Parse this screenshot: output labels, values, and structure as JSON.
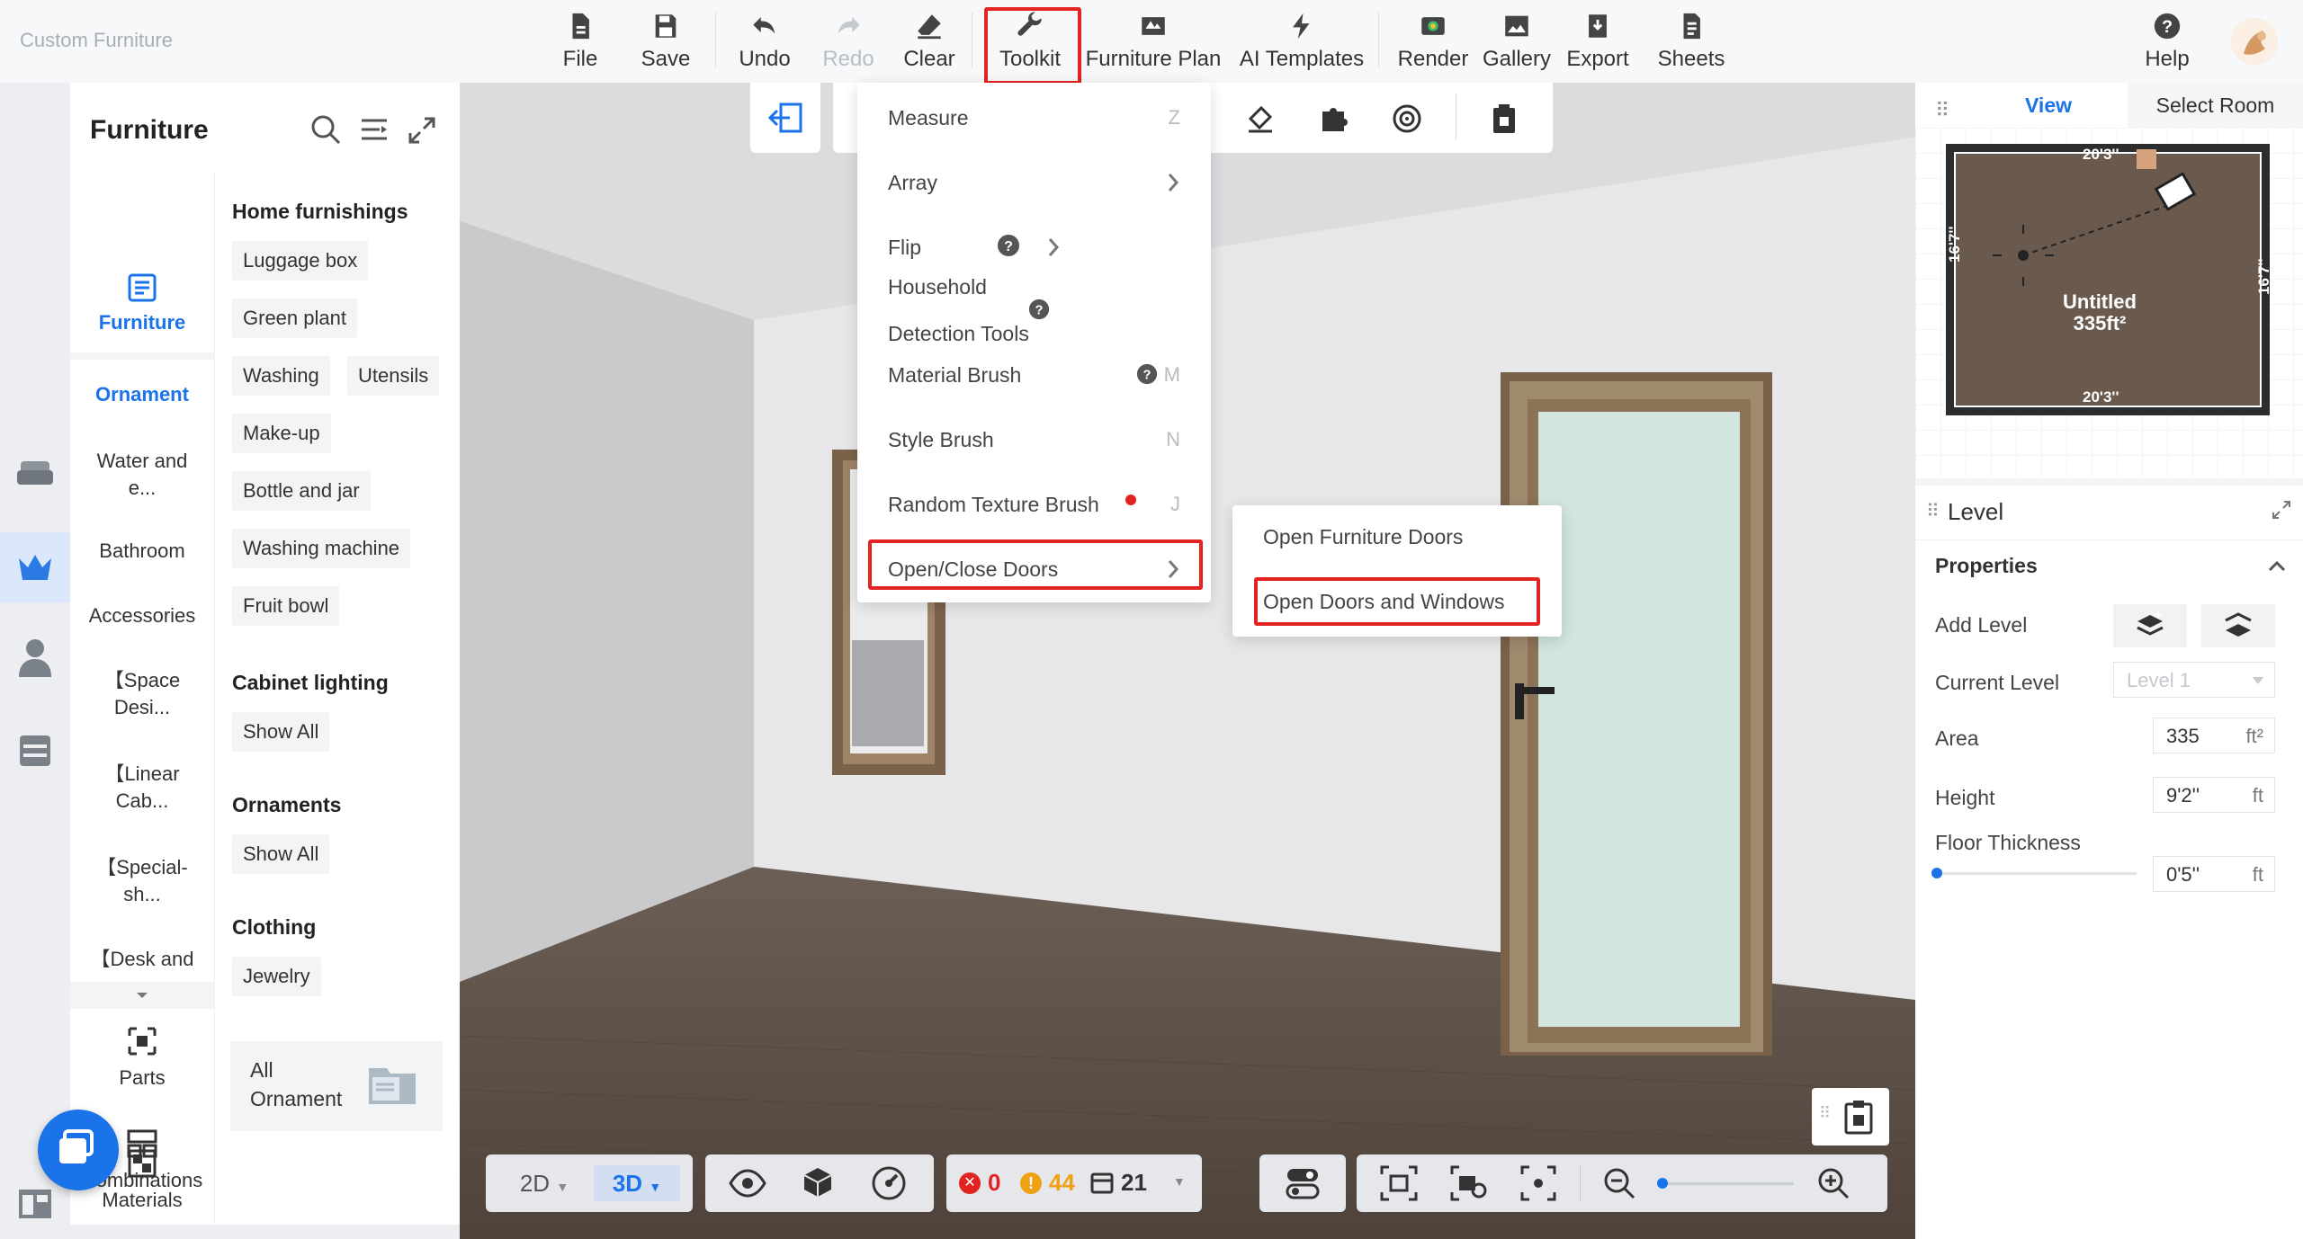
{
  "app": {
    "title": "Custom Furniture"
  },
  "toolbar": {
    "file": "File",
    "save": "Save",
    "undo": "Undo",
    "redo": "Redo",
    "clear": "Clear",
    "toolkit": "Toolkit",
    "furniture_plan": "Furniture Plan",
    "ai_templates": "AI Templates",
    "render": "Render",
    "gallery": "Gallery",
    "export": "Export",
    "sheets": "Sheets",
    "help": "Help"
  },
  "furniture_panel": {
    "title": "Furniture",
    "categories": [
      {
        "label": "Furniture"
      },
      {
        "label": "Ornament"
      },
      {
        "label": "Water and e..."
      },
      {
        "label": "Bathroom"
      },
      {
        "label": "Accessories"
      },
      {
        "label": "【Space Desi..."
      },
      {
        "label": "【Linear Cab..."
      },
      {
        "label": "【Special-sh..."
      },
      {
        "label": "【Desk and"
      },
      {
        "label": "Parts"
      },
      {
        "label": "Combinations"
      },
      {
        "label": "Materials"
      }
    ],
    "sections": {
      "home": {
        "title": "Home furnishings",
        "items": [
          "Luggage box",
          "Green plant",
          "Washing",
          "Utensils",
          "Make-up",
          "Bottle and jar",
          "Washing machine",
          "Fruit bowl"
        ]
      },
      "cabinet": {
        "title": "Cabinet lighting",
        "show_all": "Show All"
      },
      "ornaments": {
        "title": "Ornaments",
        "show_all": "Show All"
      },
      "clothing": {
        "title": "Clothing",
        "items": [
          "Jewelry"
        ]
      }
    },
    "all_ornament": "All Ornament"
  },
  "toolkit_menu": {
    "items": {
      "measure": "Measure",
      "measure_key": "Z",
      "array": "Array",
      "flip": "Flip",
      "household": "Household",
      "detection": "Detection Tools",
      "material_brush": "Material Brush",
      "material_brush_key": "M",
      "style_brush": "Style Brush",
      "style_brush_key": "N",
      "random_texture": "Random Texture Brush",
      "random_texture_key": "J",
      "open_close_doors": "Open/Close Doors"
    },
    "submenu": {
      "open_furniture_doors": "Open Furniture Doors",
      "open_doors_windows": "Open Doors and Windows"
    }
  },
  "right_panel": {
    "tabs": {
      "view": "View",
      "select_room": "Select Room"
    },
    "plan": {
      "room_name": "Untitled",
      "room_area": "335ft²",
      "dim_top": "20'3''",
      "dim_bottom": "20'3''",
      "dim_left": "16'7''",
      "dim_right": "16'7''"
    },
    "level": {
      "title": "Level",
      "properties": "Properties",
      "add_level": "Add Level",
      "current_level": "Current Level",
      "current_level_value": "Level 1",
      "area": "Area",
      "area_value": "335",
      "area_unit": "ft²",
      "height": "Height",
      "height_value": "9'2''",
      "height_unit": "ft",
      "floor_thickness": "Floor Thickness",
      "floor_thickness_value": "0'5''",
      "floor_thickness_unit": "ft"
    }
  },
  "bottom_bar": {
    "view_2d": "2D",
    "view_3d": "3D",
    "errors": "0",
    "warnings": "44",
    "items": "21"
  },
  "colors": {
    "accent": "#1a73e8",
    "highlight": "#e32222",
    "floor": "#5b4e45",
    "wall": "#e7e7e9"
  }
}
